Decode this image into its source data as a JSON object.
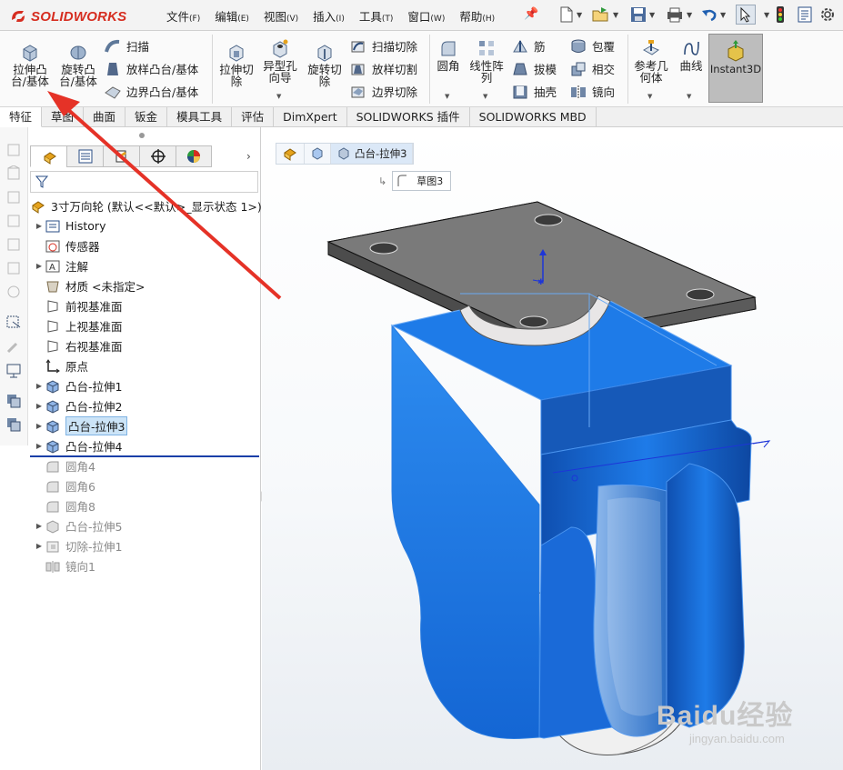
{
  "app": {
    "brand": "SOLIDWORKS"
  },
  "menu": [
    {
      "label": "文件",
      "key": "(F)"
    },
    {
      "label": "编辑",
      "key": "(E)"
    },
    {
      "label": "视图",
      "key": "(V)"
    },
    {
      "label": "插入",
      "key": "(I)"
    },
    {
      "label": "工具",
      "key": "(T)"
    },
    {
      "label": "窗口",
      "key": "(W)"
    },
    {
      "label": "帮助",
      "key": "(H)"
    }
  ],
  "ribbon": {
    "extrude_boss": "拉伸凸\n台/基体",
    "revolve_boss": "旋转凸\n台/基体",
    "sweep": "扫描",
    "loft_boss": "放样凸台/基体",
    "boundary_boss": "边界凸台/基体",
    "extrude_cut": "拉伸切\n除",
    "hole_wizard": "异型孔\n向导",
    "revolve_cut": "旋转切\n除",
    "swept_cut": "扫描切除",
    "lofted_cut": "放样切割",
    "boundary_cut": "边界切除",
    "fillet": "圆角",
    "linear_pattern": "线性阵\n列",
    "rib": "筋",
    "draft": "拔模",
    "shell": "抽壳",
    "wrap": "包覆",
    "intersect": "相交",
    "mirror": "镜向",
    "ref_geometry": "参考几\n何体",
    "curves": "曲线",
    "instant3d": "Instant3D"
  },
  "tabs": [
    "特征",
    "草图",
    "曲面",
    "钣金",
    "模具工具",
    "评估",
    "DimXpert",
    "SOLIDWORKS 插件",
    "SOLIDWORKS MBD"
  ],
  "tree": {
    "root": "3寸万向轮 (默认<<默认>_显示状态 1>)",
    "items": [
      {
        "label": "History",
        "expand": true,
        "state": "normal"
      },
      {
        "label": "传感器",
        "expand": false,
        "state": "normal"
      },
      {
        "label": "注解",
        "expand": true,
        "state": "normal"
      },
      {
        "label": "材质 <未指定>",
        "expand": false,
        "state": "normal"
      },
      {
        "label": "前视基准面",
        "expand": false,
        "state": "normal"
      },
      {
        "label": "上视基准面",
        "expand": false,
        "state": "normal"
      },
      {
        "label": "右视基准面",
        "expand": false,
        "state": "normal"
      },
      {
        "label": "原点",
        "expand": false,
        "state": "normal"
      },
      {
        "label": "凸台-拉伸1",
        "expand": true,
        "state": "normal"
      },
      {
        "label": "凸台-拉伸2",
        "expand": true,
        "state": "normal"
      },
      {
        "label": "凸台-拉伸3",
        "expand": true,
        "state": "selected"
      },
      {
        "label": "凸台-拉伸4",
        "expand": true,
        "state": "normal"
      },
      {
        "label": "圆角4",
        "expand": false,
        "state": "suppressed"
      },
      {
        "label": "圆角6",
        "expand": false,
        "state": "suppressed"
      },
      {
        "label": "圆角8",
        "expand": false,
        "state": "suppressed"
      },
      {
        "label": "凸台-拉伸5",
        "expand": true,
        "state": "suppressed"
      },
      {
        "label": "切除-拉伸1",
        "expand": true,
        "state": "suppressed"
      },
      {
        "label": "镜向1",
        "expand": false,
        "state": "suppressed"
      }
    ]
  },
  "breadcrumb": {
    "current": "凸台-拉伸3",
    "sketch": "草图3"
  },
  "watermark": {
    "brand": "Baidu经验",
    "url": "jingyan.baidu.com"
  },
  "colors": {
    "accent_red": "#d62d20",
    "model_blue": "#1e7be8",
    "selection": "#cce4f7"
  }
}
